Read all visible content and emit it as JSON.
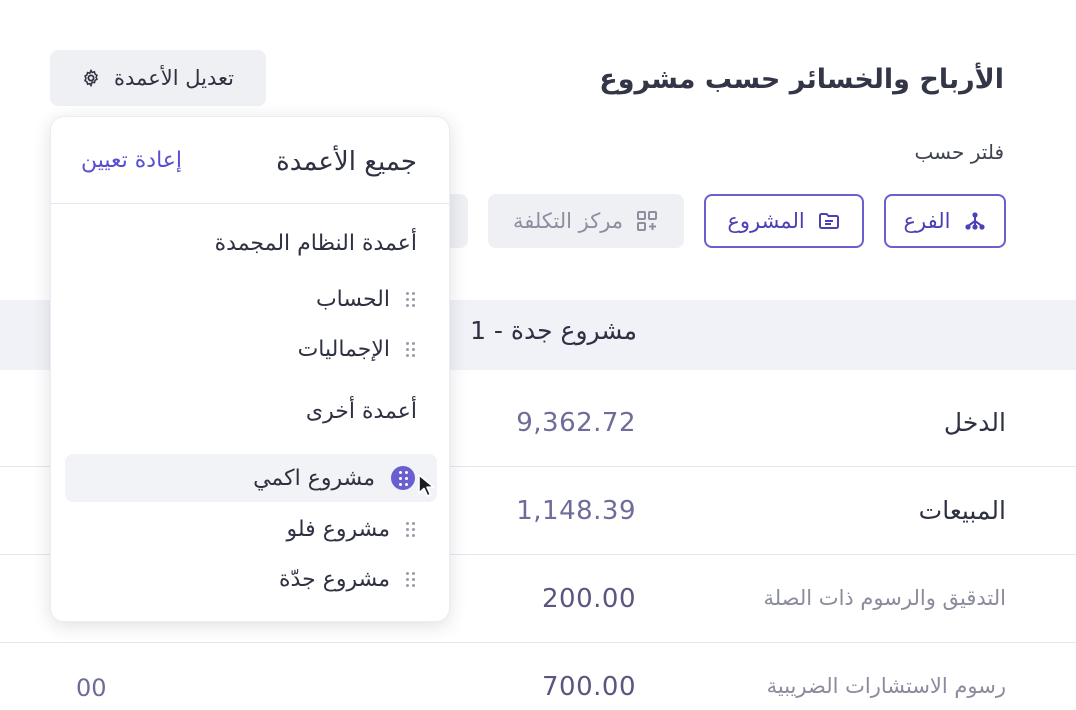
{
  "header": {
    "title": "الأرباح والخسائر حسب مشروع",
    "filter_label": "فلتر حسب",
    "edit_columns_label": "تعديل الأعمدة"
  },
  "filters": {
    "branch": "الفرع",
    "project": "المشروع",
    "cost_center": "مركز التكلفة"
  },
  "table": {
    "column_header": "مشروع جدة - 1",
    "rows": [
      {
        "label": "الدخل",
        "value": "9,362.72"
      },
      {
        "label": "المبيعات",
        "value": "1,148.39"
      },
      {
        "label": "التدقيق والرسوم ذات الصلة",
        "value": "200.00"
      },
      {
        "label": "رسوم الاستشارات الضريبية",
        "value": "700.00"
      }
    ],
    "cut_value": "00"
  },
  "dropdown": {
    "title": "جميع الأعمدة",
    "reset_label": "إعادة تعيين",
    "groups": [
      {
        "label": "أعمدة النظام المجمدة",
        "items": [
          "الحساب",
          "الإجماليات"
        ]
      },
      {
        "label": "أعمدة أخرى",
        "items": [
          "مشروع اكمي",
          "مشروع فلو",
          "مشروع جدّة"
        ]
      }
    ]
  },
  "colors": {
    "accent": "#6a5fd0",
    "text": "#2e3142",
    "muted": "#8a8c9d",
    "value": "#6e6c9a"
  }
}
